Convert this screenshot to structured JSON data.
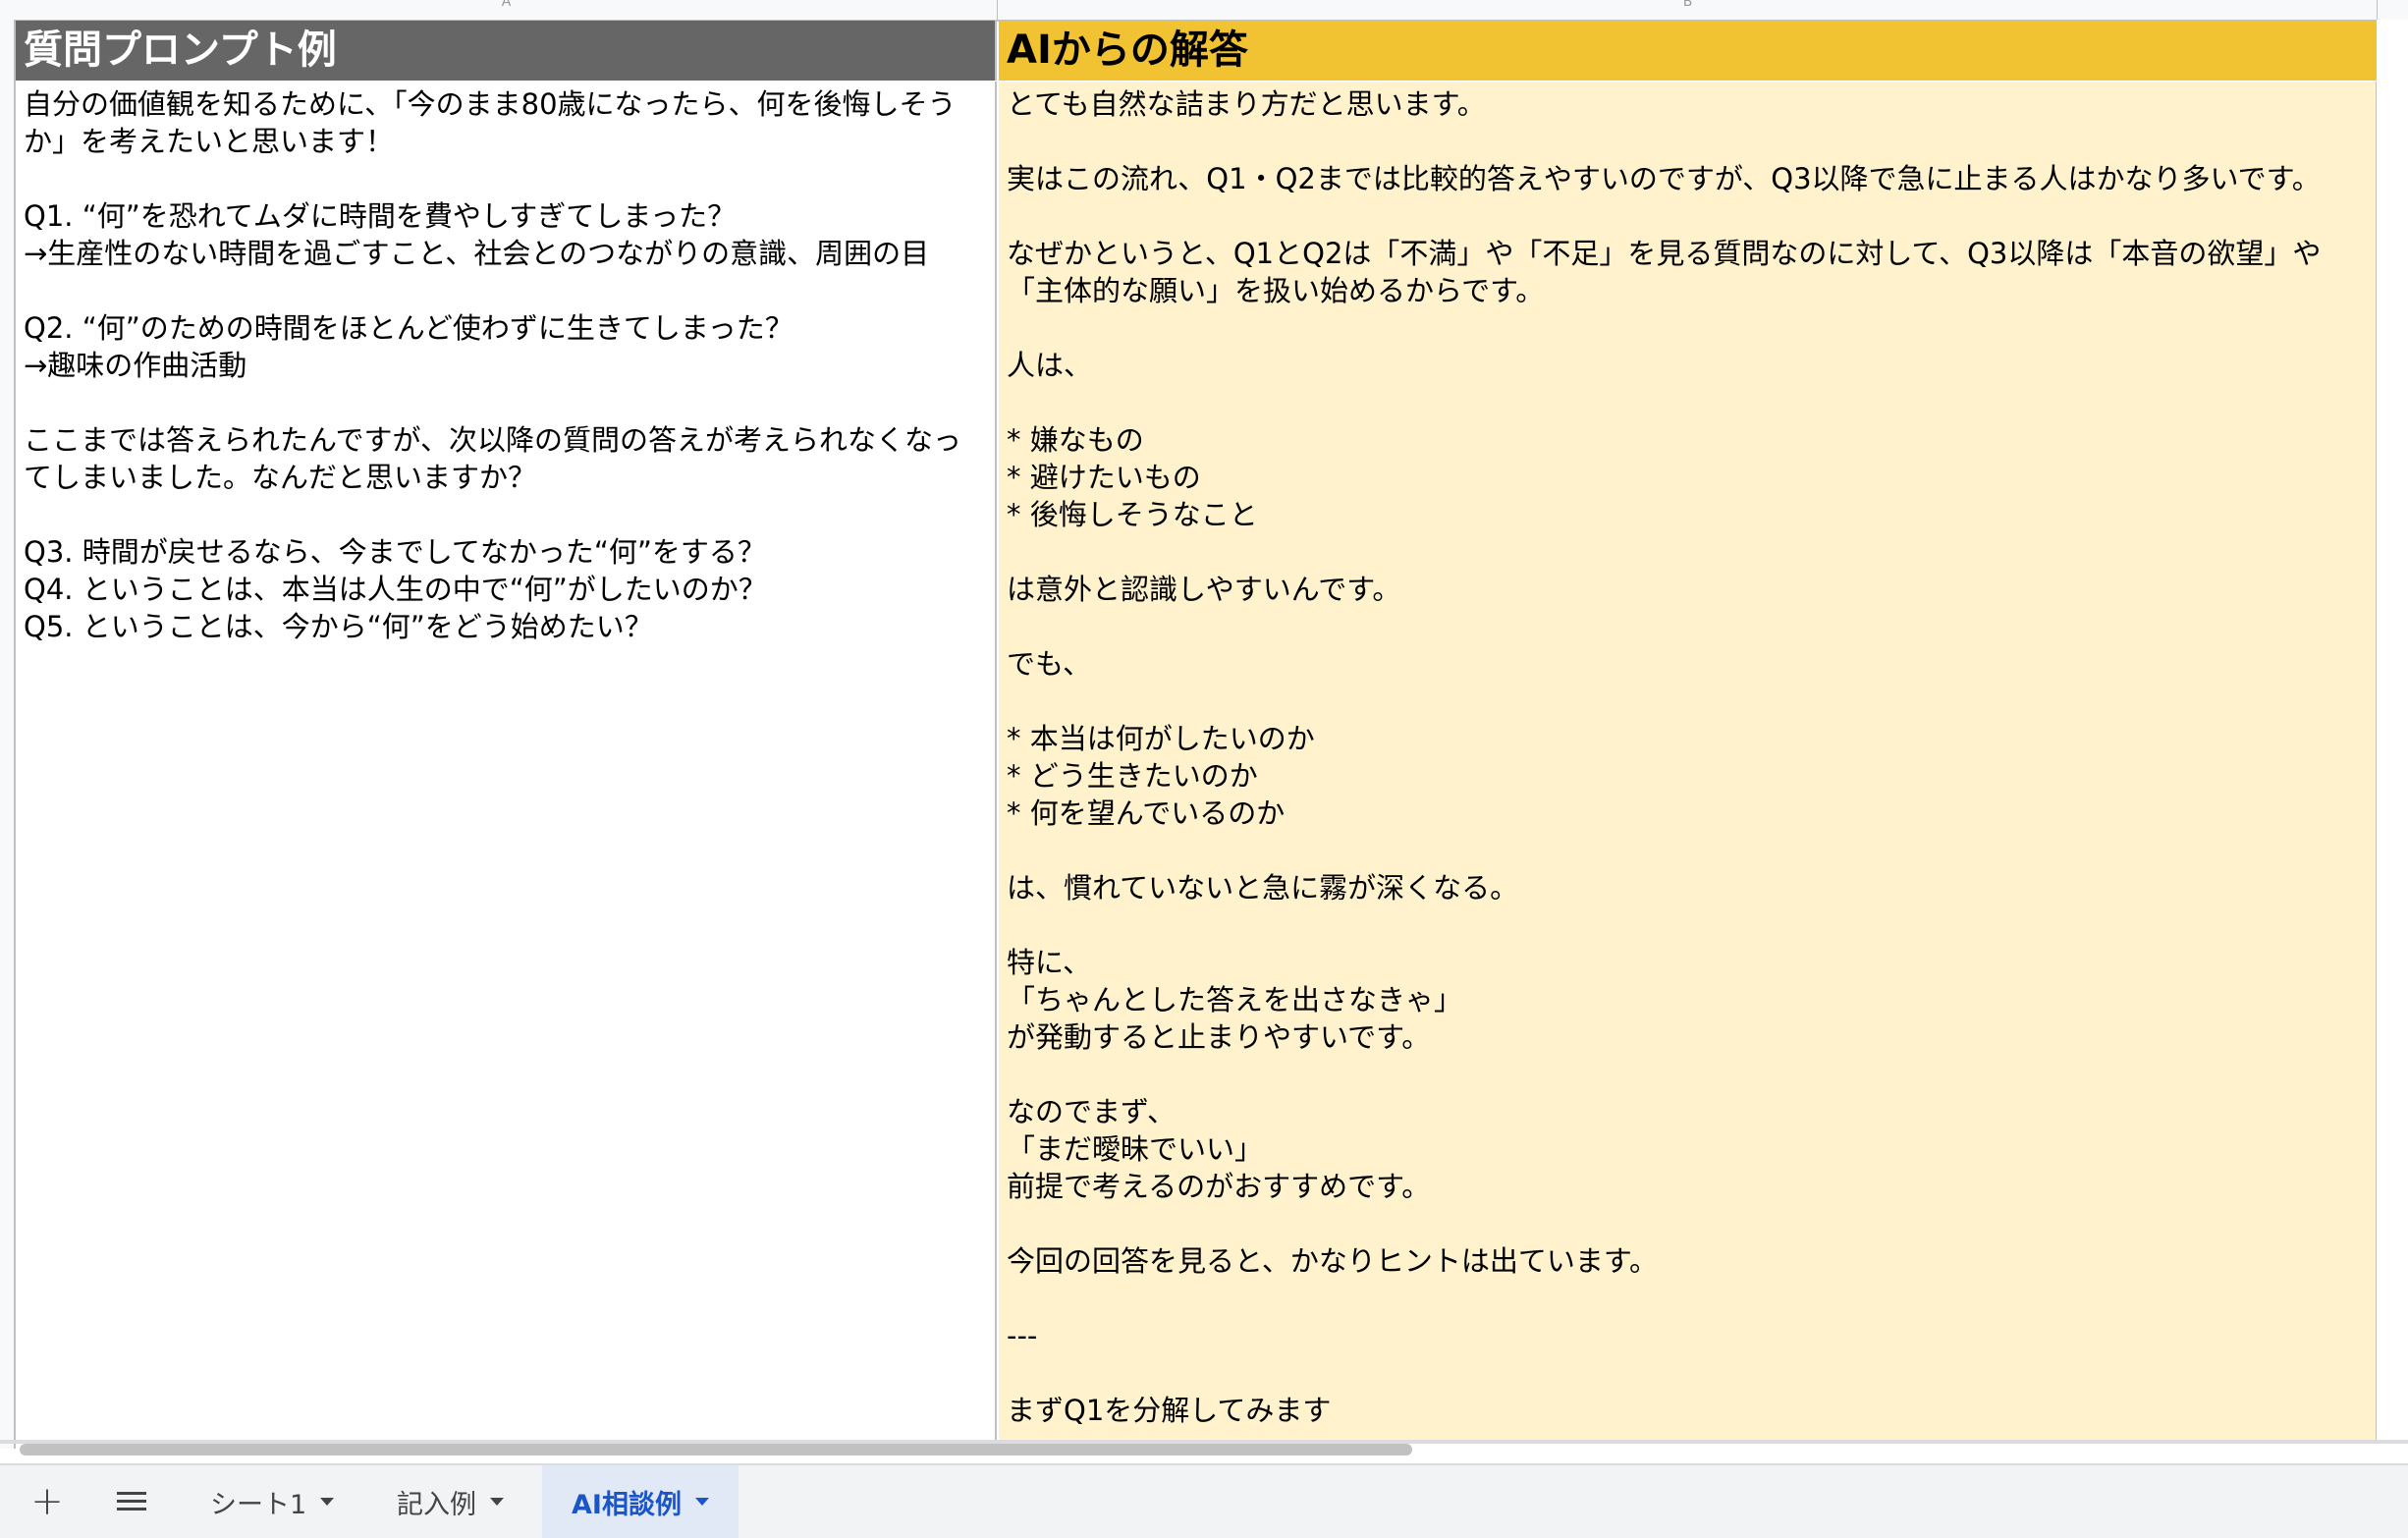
{
  "column_headers": [
    "A",
    "B"
  ],
  "header_a": "質問プロンプト例",
  "header_b": "AIからの解答",
  "cell_a": "自分の価値観を知るために、「今のまま80歳になったら、何を後悔しそうか」を考えたいと思います！\n\nQ1. “何”を恐れてムダに時間を費やしすぎてしまった？\n→生産性のない時間を過ごすこと、社会とのつながりの意識、周囲の目\n\nQ2. “何”のための時間をほとんど使わずに生きてしまった？\n→趣味の作曲活動\n\nここまでは答えられたんですが、次以降の質問の答えが考えられなくなってしまいました。なんだと思いますか？\n\nQ3. 時間が戻せるなら、今までしてなかった“何”をする？\nQ4. ということは、本当は人生の中で“何”がしたいのか？\nQ5. ということは、今から“何”をどう始めたい？",
  "cell_b": "とても自然な詰まり方だと思います。\n\n実はこの流れ、Q1・Q2までは比較的答えやすいのですが、Q3以降で急に止まる人はかなり多いです。\n\nなぜかというと、Q1とQ2は「不満」や「不足」を見る質問なのに対して、Q3以降は「本音の欲望」や「主体的な願い」を扱い始めるからです。\n\n人は、\n\n* 嫌なもの\n* 避けたいもの\n* 後悔しそうなこと\n\nは意外と認識しやすいんです。\n\nでも、\n\n* 本当は何がしたいのか\n* どう生きたいのか\n* 何を望んでいるのか\n\nは、慣れていないと急に霧が深くなる。\n\n特に、\n「ちゃんとした答えを出さなきゃ」\nが発動すると止まりやすいです。\n\nなのでまず、\n「まだ曖昧でいい」\n前提で考えるのがおすすめです。\n\n今回の回答を見ると、かなりヒントは出ています。\n\n---\n\nまずQ1を分解してみます",
  "tabbar": {
    "add_label": "+",
    "tabs": [
      {
        "label": "シート1"
      },
      {
        "label": "記入例"
      },
      {
        "label": "AI相談例"
      }
    ]
  },
  "colors": {
    "header_a_bg": "#666666",
    "header_b_bg": "#f1c232",
    "col_b_bg": "#fff2cc",
    "active_tab": "#1a56c9"
  },
  "icons": [
    "plus-icon",
    "menu-icon",
    "dropdown-arrow-icon"
  ]
}
